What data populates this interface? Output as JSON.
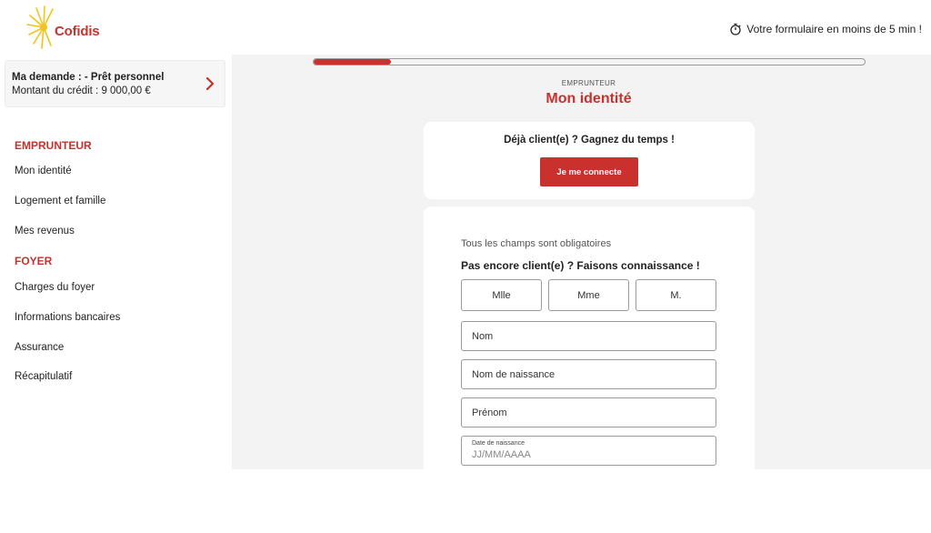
{
  "header": {
    "logo_text": "Cofidis",
    "timer_text": "Votre formulaire en moins de 5 min !"
  },
  "sidebar": {
    "demande_line1": "Ma demande : - Prêt personnel",
    "demande_line2": "Montant du crédit : 9 000,00 €",
    "sections": [
      {
        "heading": "EMPRUNTEUR",
        "items": [
          "Mon identité",
          "Logement et famille",
          "Mes revenus"
        ]
      },
      {
        "heading": "FOYER",
        "items": [
          "Charges du foyer",
          "Informations bancaires",
          "Assurance",
          "Récapitulatif"
        ]
      }
    ]
  },
  "main": {
    "progress": 0.14,
    "step_label": "EMPRUNTEUR",
    "page_title": "Mon identité",
    "client_card": {
      "title": "Déjà client(e) ? Gagnez du temps !",
      "button_label": "Je me connecte"
    },
    "form": {
      "required_note": "Tous les champs sont obligatoires",
      "title": "Pas encore client(e) ? Faisons connaissance !",
      "civility_options": [
        "Mlle",
        "Mme",
        "M."
      ],
      "nom": "Nom",
      "nom_naissance": "Nom de naissance",
      "prenom": "Prénom",
      "date_label": "Date de naissance",
      "date_placeholder": "JJ/MM/AAAA"
    }
  },
  "colors": {
    "brand_red": "#c8312d",
    "logo_sun": "#f2c319",
    "main_bg": "#f3f3f3"
  }
}
